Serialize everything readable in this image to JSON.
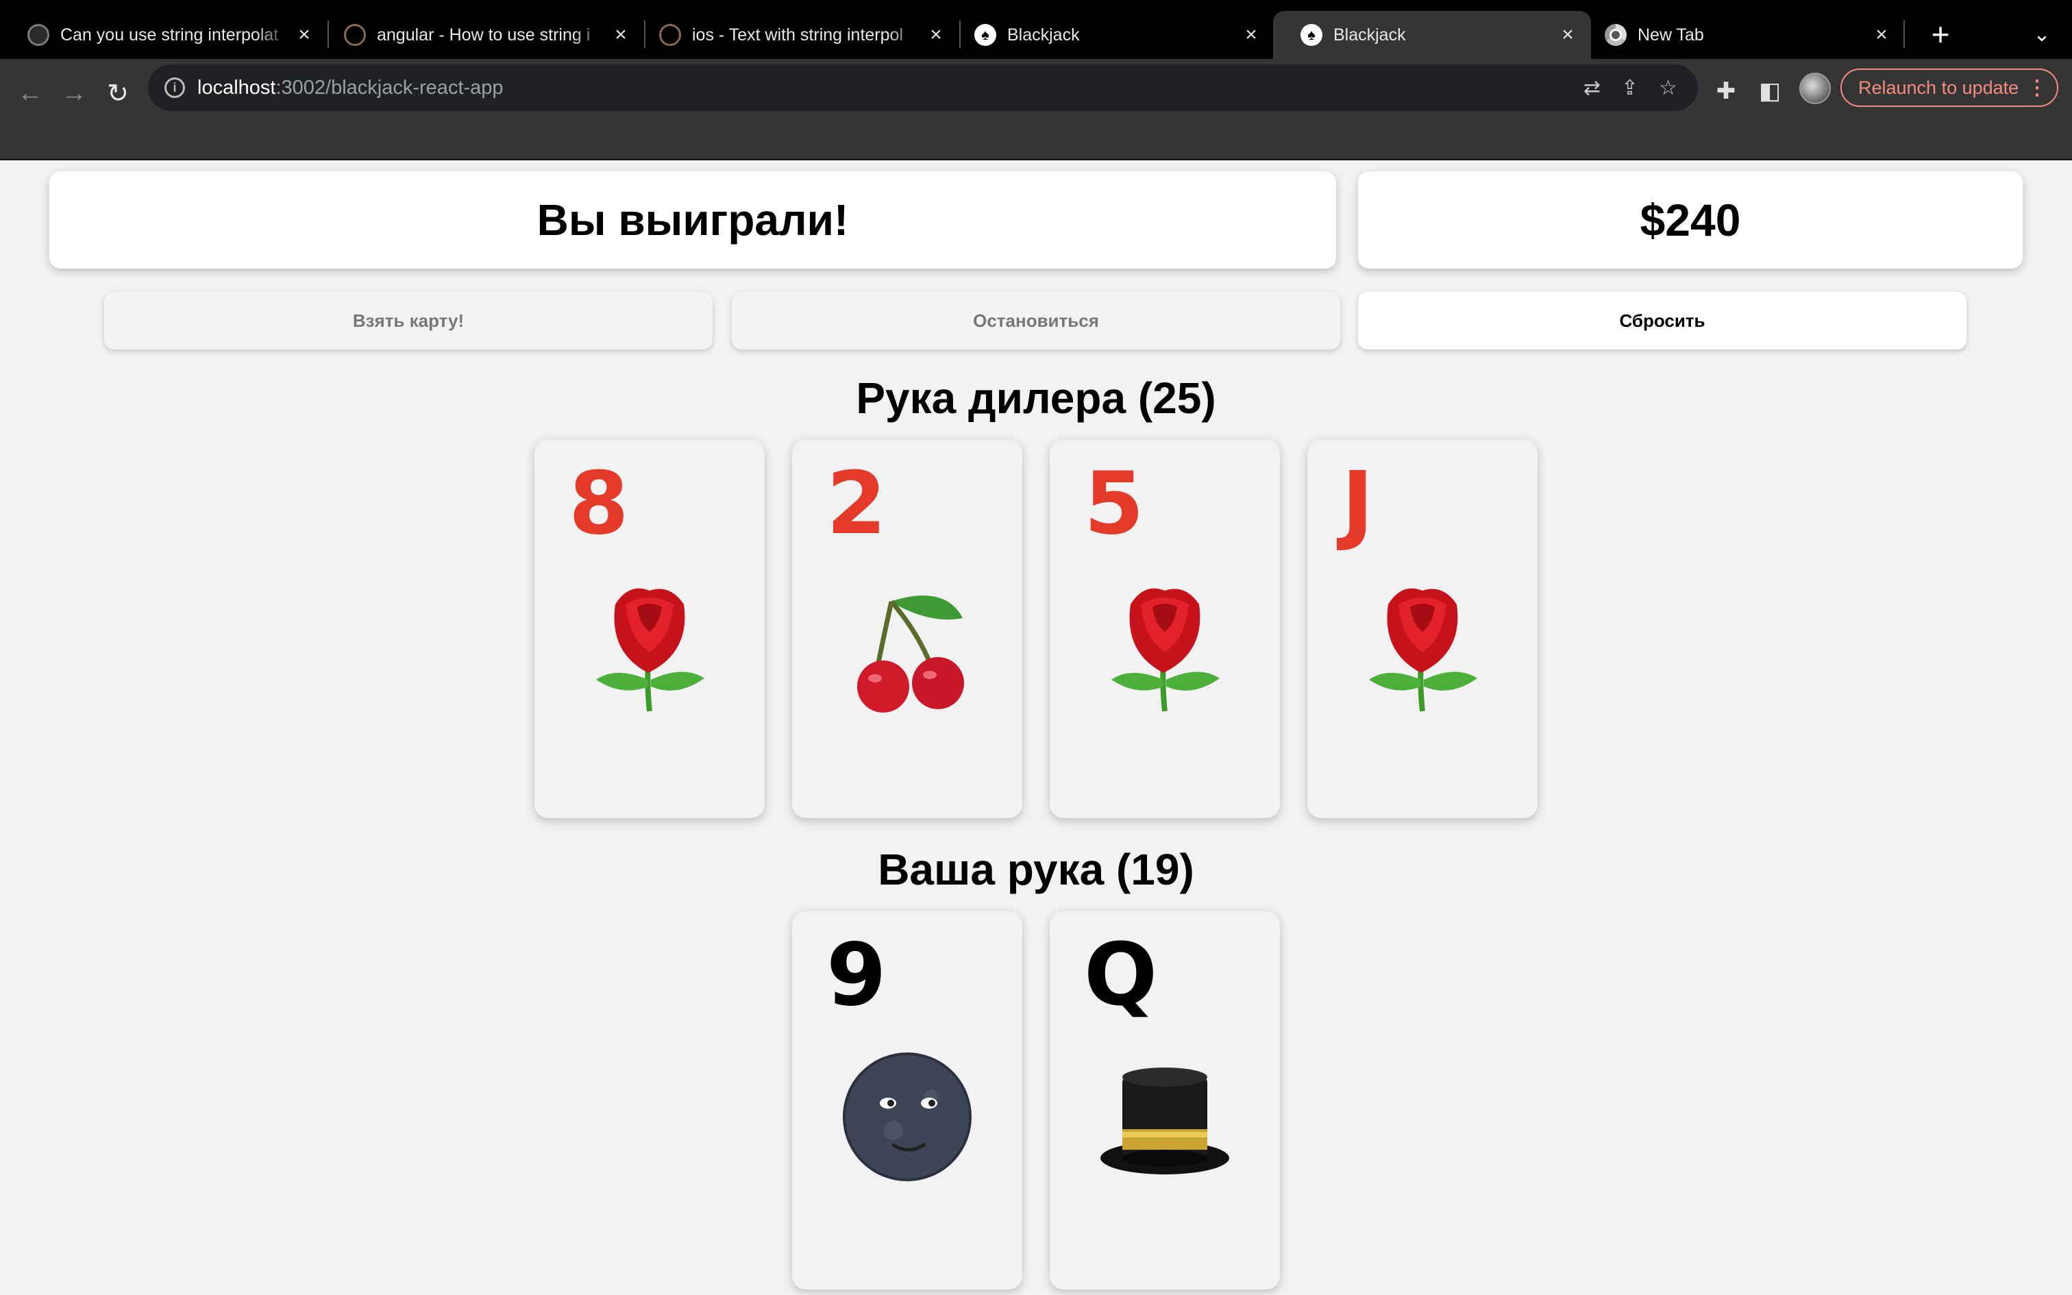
{
  "browser": {
    "tabs": [
      {
        "title": "Can you use string interpolat",
        "favicon": "github-icon"
      },
      {
        "title": "angular - How to use string i",
        "favicon": "stackoverflow-icon"
      },
      {
        "title": "ios - Text with string interpol",
        "favicon": "stackoverflow-icon"
      },
      {
        "title": "Blackjack",
        "favicon": "cards-icon"
      },
      {
        "title": "Blackjack",
        "favicon": "cards-icon",
        "active": true
      },
      {
        "title": "New Tab",
        "favicon": "chrome-icon"
      }
    ],
    "url_host": "localhost",
    "url_path": ":3002/blackjack-react-app",
    "relaunch_label": "Relaunch to update",
    "accent_color": "#f28b82"
  },
  "game": {
    "status_message": "Вы выиграли!",
    "balance": "$240",
    "buttons": {
      "hit": "Взять карту!",
      "stand": "Остановиться",
      "reset": "Сбросить"
    },
    "dealer_title": "Рука дилера (25)",
    "player_title": "Ваша рука (19)",
    "dealer_cards": [
      {
        "rank": "8",
        "color": "red",
        "suit_icon": "rose-icon"
      },
      {
        "rank": "2",
        "color": "red",
        "suit_icon": "cherries-icon"
      },
      {
        "rank": "5",
        "color": "red",
        "suit_icon": "rose-icon"
      },
      {
        "rank": "J",
        "color": "red",
        "suit_icon": "rose-icon"
      }
    ],
    "player_cards": [
      {
        "rank": "9",
        "color": "black",
        "suit_icon": "new-moon-face-icon"
      },
      {
        "rank": "Q",
        "color": "black",
        "suit_icon": "top-hat-icon"
      }
    ],
    "colors": {
      "red_rank": "#e43a2a",
      "black_rank": "#000000"
    }
  }
}
